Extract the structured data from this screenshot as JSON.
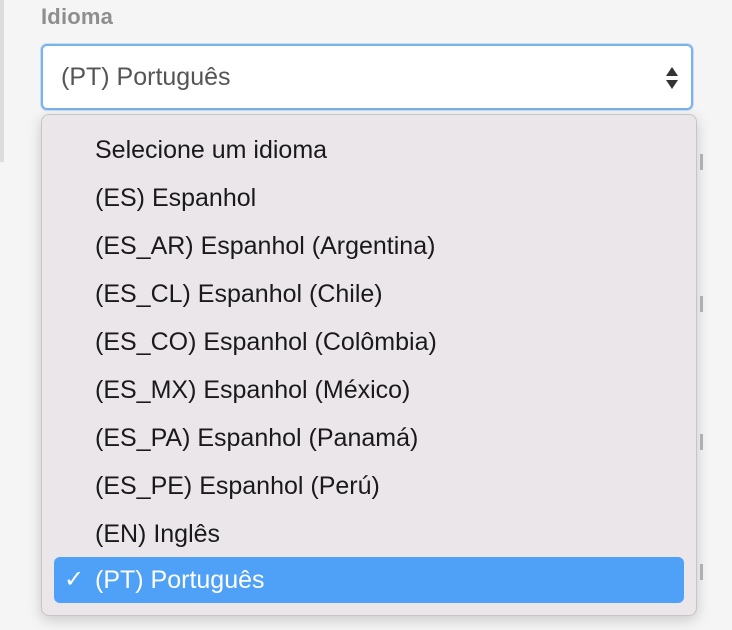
{
  "field": {
    "label": "Idioma",
    "selected_value": "(PT) Português"
  },
  "icons": {
    "select_arrows": "updown-arrows-icon",
    "checkmark": "checkmark-icon",
    "check_glyph": "✓"
  },
  "dropdown": {
    "options": [
      {
        "label": "Selecione um idioma",
        "selected": false
      },
      {
        "label": "(ES) Espanhol",
        "selected": false
      },
      {
        "label": "(ES_AR) Espanhol (Argentina)",
        "selected": false
      },
      {
        "label": "(ES_CL) Espanhol (Chile)",
        "selected": false
      },
      {
        "label": "(ES_CO) Espanhol (Colômbia)",
        "selected": false
      },
      {
        "label": "(ES_MX) Espanhol (México)",
        "selected": false
      },
      {
        "label": "(ES_PA) Espanhol (Panamá)",
        "selected": false
      },
      {
        "label": "(ES_PE) Espanhol (Perú)",
        "selected": false
      },
      {
        "label": "(EN) Inglês",
        "selected": false
      },
      {
        "label": "(PT) Português",
        "selected": true
      }
    ]
  },
  "colors": {
    "highlight": "#4fa0f7",
    "focus_border": "#7ab3ea",
    "label_gray": "#8e8e8e",
    "menu_bg": "#ebe6ea"
  }
}
